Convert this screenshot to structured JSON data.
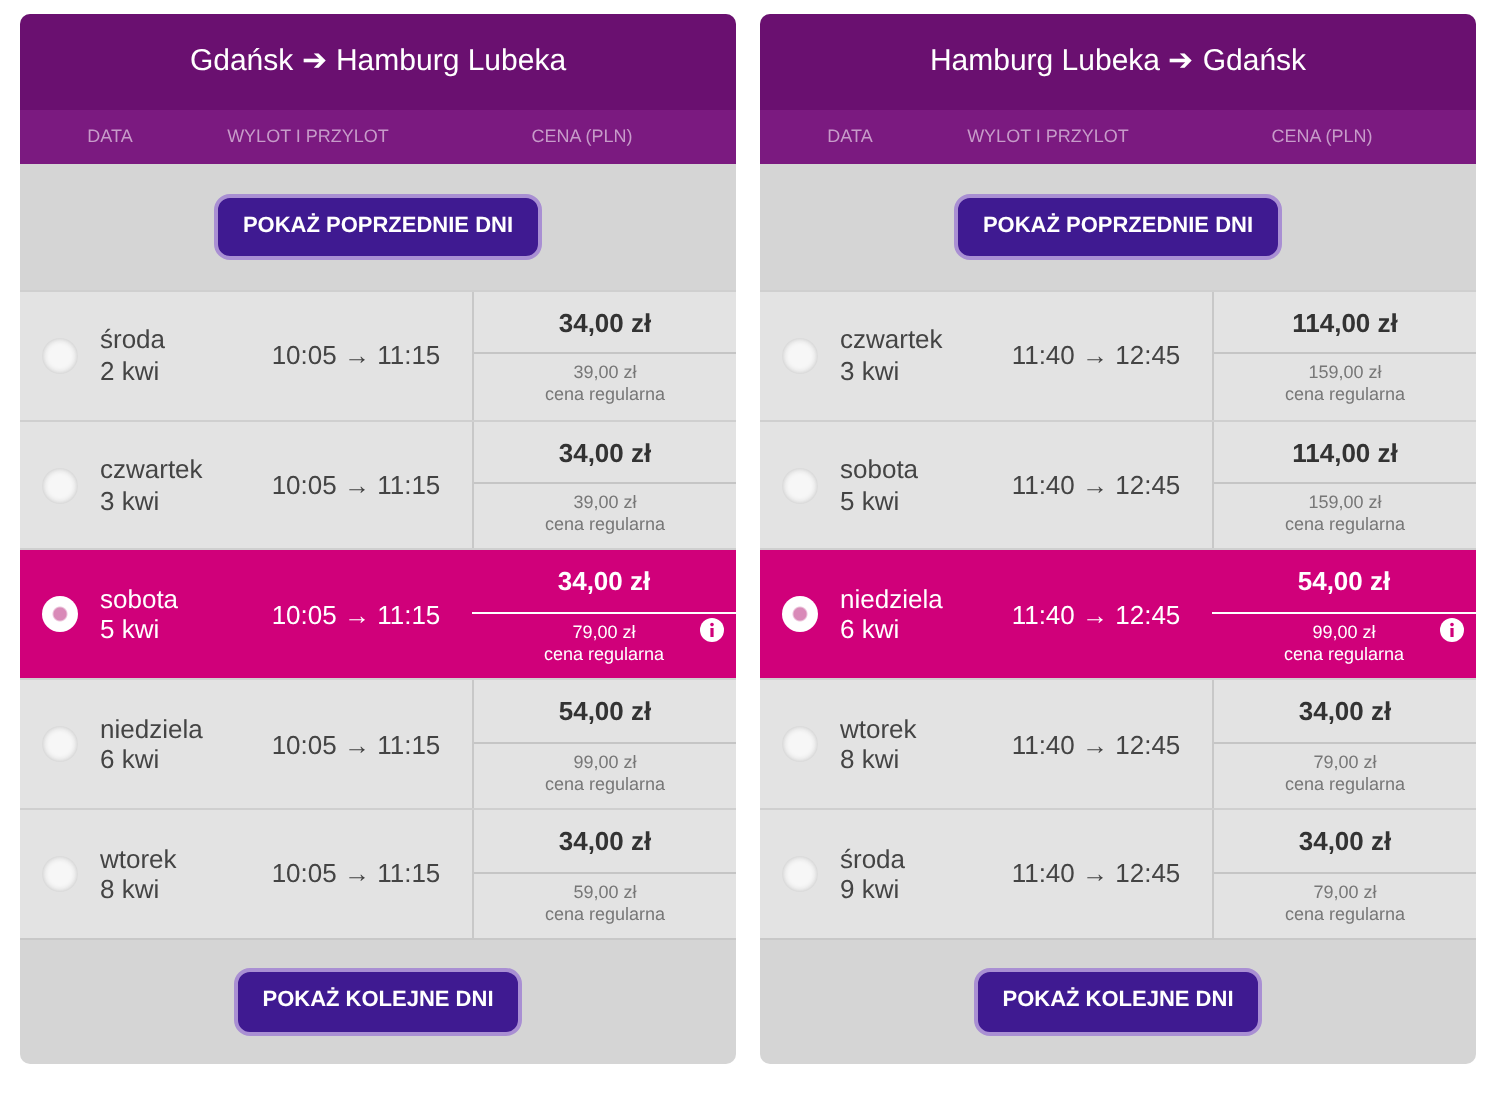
{
  "panels": [
    {
      "title": "Gdańsk ➔ Hamburg Lubeka",
      "columns": [
        "DATA",
        "WYLOT I PRZYLOT",
        "CENA (PLN)"
      ],
      "prev_button": "POKAŻ POPRZEDNIE DNI",
      "next_button": "POKAŻ KOLEJNE DNI",
      "rows": [
        {
          "day": "środa",
          "date": "2 kwi",
          "time": "10:05 → 11:15",
          "price": "34,00 zł",
          "regular_price": "39,00 zł",
          "regular_label": "cena regularna",
          "selected": false
        },
        {
          "day": "czwartek",
          "date": "3 kwi",
          "time": "10:05 → 11:15",
          "price": "34,00 zł",
          "regular_price": "39,00 zł",
          "regular_label": "cena regularna",
          "selected": false
        },
        {
          "day": "sobota",
          "date": "5 kwi",
          "time": "10:05 → 11:15",
          "price": "34,00 zł",
          "regular_price": "79,00 zł",
          "regular_label": "cena regularna",
          "selected": true
        },
        {
          "day": "niedziela",
          "date": "6 kwi",
          "time": "10:05 → 11:15",
          "price": "54,00 zł",
          "regular_price": "99,00 zł",
          "regular_label": "cena regularna",
          "selected": false
        },
        {
          "day": "wtorek",
          "date": "8 kwi",
          "time": "10:05 → 11:15",
          "price": "34,00 zł",
          "regular_price": "59,00 zł",
          "regular_label": "cena regularna",
          "selected": false
        }
      ]
    },
    {
      "title": "Hamburg Lubeka ➔ Gdańsk",
      "columns": [
        "DATA",
        "WYLOT I PRZYLOT",
        "CENA (PLN)"
      ],
      "prev_button": "POKAŻ POPRZEDNIE DNI",
      "next_button": "POKAŻ KOLEJNE DNI",
      "rows": [
        {
          "day": "czwartek",
          "date": "3 kwi",
          "time": "11:40 → 12:45",
          "price": "114,00 zł",
          "regular_price": "159,00 zł",
          "regular_label": "cena regularna",
          "selected": false
        },
        {
          "day": "sobota",
          "date": "5 kwi",
          "time": "11:40 → 12:45",
          "price": "114,00 zł",
          "regular_price": "159,00 zł",
          "regular_label": "cena regularna",
          "selected": false
        },
        {
          "day": "niedziela",
          "date": "6 kwi",
          "time": "11:40 → 12:45",
          "price": "54,00 zł",
          "regular_price": "99,00 zł",
          "regular_label": "cena regularna",
          "selected": true
        },
        {
          "day": "wtorek",
          "date": "8 kwi",
          "time": "11:40 → 12:45",
          "price": "34,00 zł",
          "regular_price": "79,00 zł",
          "regular_label": "cena regularna",
          "selected": false
        },
        {
          "day": "środa",
          "date": "9 kwi",
          "time": "11:40 → 12:45",
          "price": "34,00 zł",
          "regular_price": "79,00 zł",
          "regular_label": "cena regularna",
          "selected": false
        }
      ]
    }
  ]
}
